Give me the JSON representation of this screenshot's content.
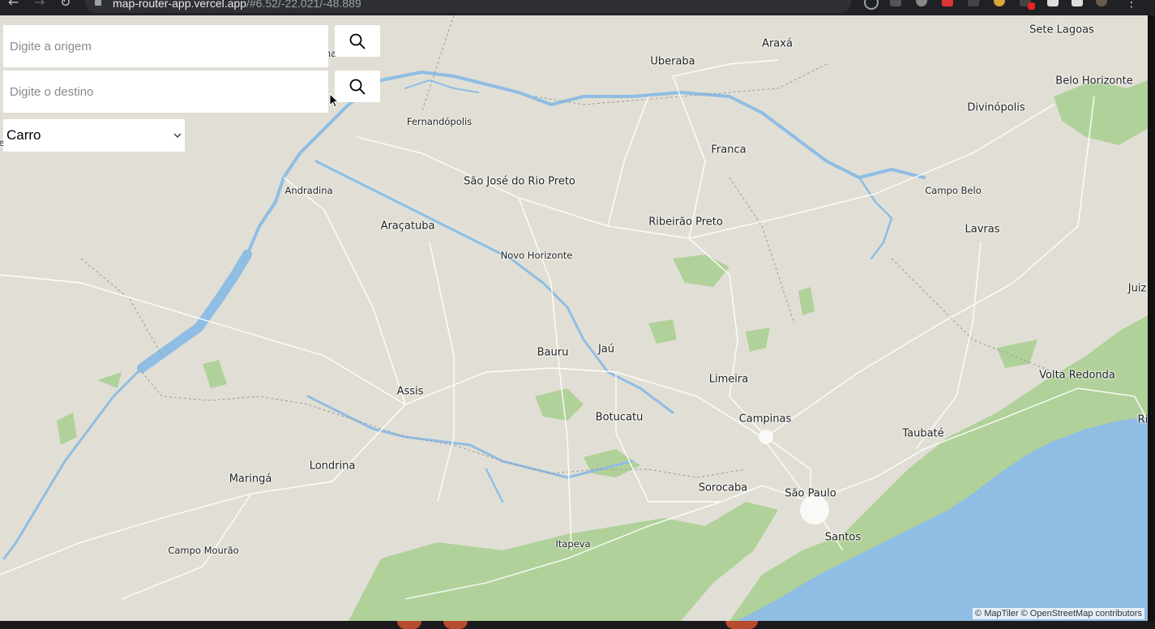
{
  "browser": {
    "url_host": "map-router-app.vercel.app",
    "url_fragment": "/#6.52/-22.021/-48.889"
  },
  "search": {
    "origin_placeholder": "Digite a origem",
    "origin_value": "",
    "destination_placeholder": "Digite o destino",
    "destination_value": "",
    "search_icon": "search-icon"
  },
  "mode_select": {
    "selected": "Carro",
    "icon": "chevron-down-icon"
  },
  "map": {
    "attribution": "© MapTiler © OpenStreetMap contributors",
    "colors": {
      "land": "#e1dfd5",
      "water": "#8fbde4",
      "forest": "#a8cf8f",
      "road": "#ffffff",
      "border": "#9a9a9a"
    },
    "cities": [
      {
        "name": "Sete Lagoas"
      },
      {
        "name": "Araxá"
      },
      {
        "name": "Uberaba"
      },
      {
        "name": "Belo Horizonte"
      },
      {
        "name": "Divinópolis"
      },
      {
        "name": "Fernandópolis"
      },
      {
        "name": "Franca"
      },
      {
        "name": "São José do Rio Preto"
      },
      {
        "name": "Andradina"
      },
      {
        "name": "Campo Belo"
      },
      {
        "name": "Araçatuba"
      },
      {
        "name": "Ribeirão Preto"
      },
      {
        "name": "Lavras"
      },
      {
        "name": "Novo Horizonte"
      },
      {
        "name": "Juiz"
      },
      {
        "name": "Bauru"
      },
      {
        "name": "Jaú"
      },
      {
        "name": "Limeira"
      },
      {
        "name": "Volta Redonda"
      },
      {
        "name": "Assis"
      },
      {
        "name": "Botucatu"
      },
      {
        "name": "Campinas"
      },
      {
        "name": "Taubaté"
      },
      {
        "name": "Ri"
      },
      {
        "name": "Londrina"
      },
      {
        "name": "Maringá"
      },
      {
        "name": "Sorocaba"
      },
      {
        "name": "São Paulo"
      },
      {
        "name": "Santos"
      },
      {
        "name": "Itapeva"
      },
      {
        "name": "Campo Mourão"
      },
      {
        "name": "e"
      },
      {
        "name": "na"
      }
    ]
  }
}
